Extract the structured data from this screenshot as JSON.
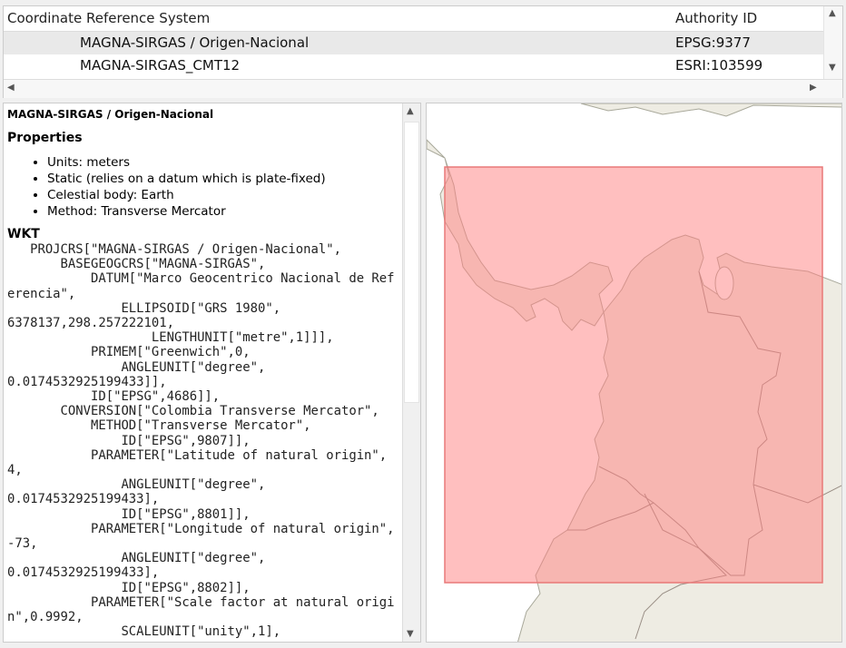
{
  "table": {
    "headers": [
      "Coordinate Reference System",
      "Authority ID"
    ],
    "rows": [
      {
        "name": "MAGNA-SIRGAS / Origen-Nacional",
        "id": "EPSG:9377"
      },
      {
        "name": "MAGNA-SIRGAS_CMT12",
        "id": "ESRI:103599"
      }
    ]
  },
  "info": {
    "title": "MAGNA-SIRGAS / Origen-Nacional",
    "properties_heading": "Properties",
    "properties": [
      "Units: meters",
      "Static (relies on a datum which is plate-fixed)",
      "Celestial body: Earth",
      "Method: Transverse Mercator"
    ],
    "wkt_heading": "WKT",
    "wkt": "   PROJCRS[\"MAGNA-SIRGAS / Origen-Nacional\",\n       BASEGEOGCRS[\"MAGNA-SIRGAS\",\n           DATUM[\"Marco Geocentrico Nacional de Ref\nerencia\",\n               ELLIPSOID[\"GRS 1980\",\n6378137,298.257222101,\n                   LENGTHUNIT[\"metre\",1]]],\n           PRIMEM[\"Greenwich\",0,\n               ANGLEUNIT[\"degree\",\n0.0174532925199433]],\n           ID[\"EPSG\",4686]],\n       CONVERSION[\"Colombia Transverse Mercator\",\n           METHOD[\"Transverse Mercator\",\n               ID[\"EPSG\",9807]],\n           PARAMETER[\"Latitude of natural origin\",\n4,\n               ANGLEUNIT[\"degree\",\n0.0174532925199433],\n               ID[\"EPSG\",8801]],\n           PARAMETER[\"Longitude of natural origin\",\n-73,\n               ANGLEUNIT[\"degree\",\n0.0174532925199433],\n               ID[\"EPSG\",8802]],\n           PARAMETER[\"Scale factor at natural origi\nn\",0.9992,\n               SCALEUNIT[\"unity\",1],"
  },
  "colors": {
    "land": "#eeece3",
    "extent_fill": "#ff9a9a",
    "extent_border": "#e88080",
    "selected_row": "#e9e9e9"
  }
}
